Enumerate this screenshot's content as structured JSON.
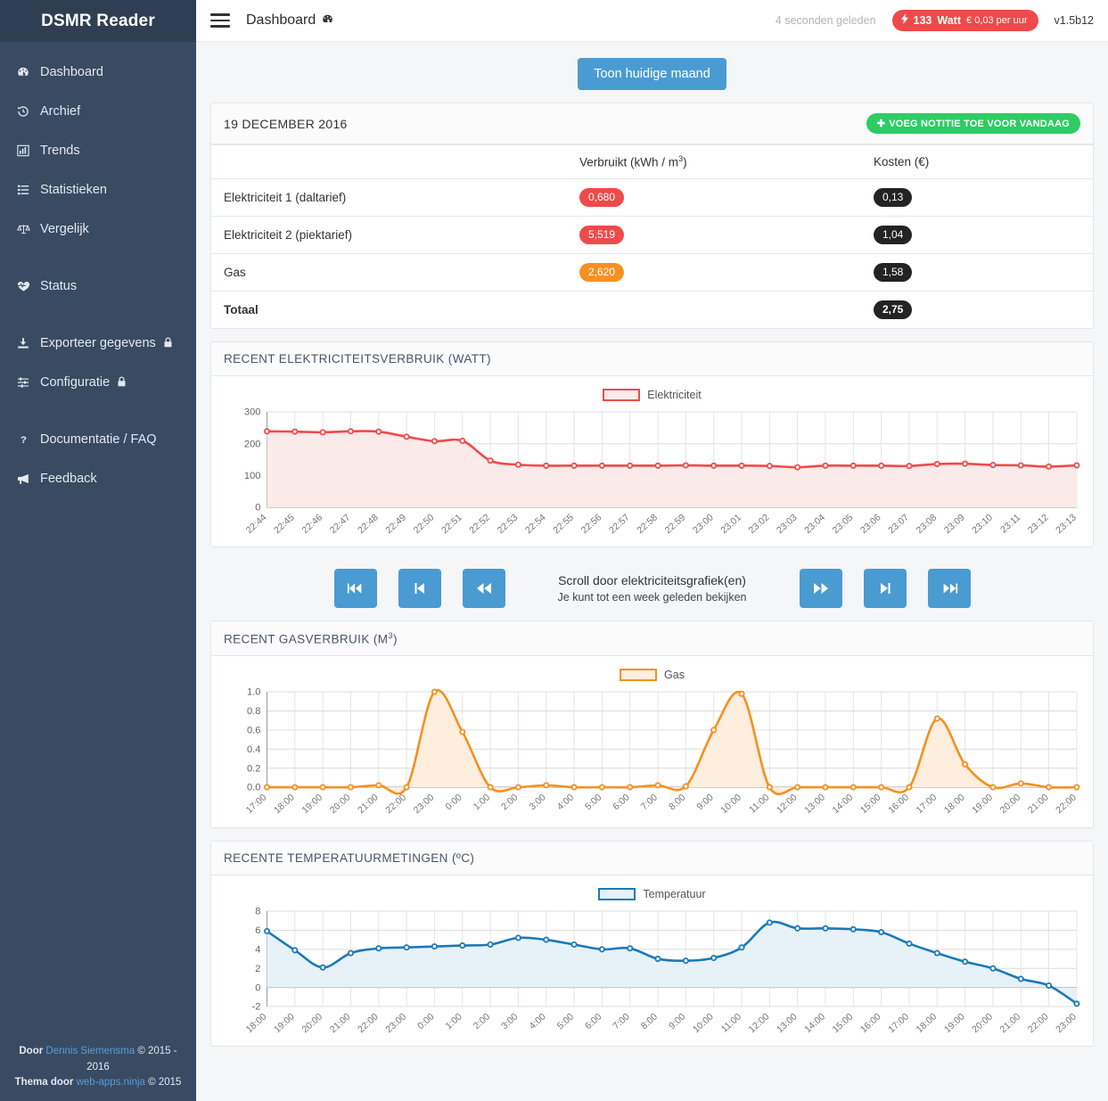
{
  "brand": {
    "name": "DSMR Reader"
  },
  "sidebar": {
    "items": [
      {
        "label": "Dashboard",
        "icon": "tachometer-icon",
        "locked": false
      },
      {
        "label": "Archief",
        "icon": "history-icon",
        "locked": false
      },
      {
        "label": "Trends",
        "icon": "bar-chart-icon",
        "locked": false
      },
      {
        "label": "Statistieken",
        "icon": "list-icon",
        "locked": false
      },
      {
        "label": "Vergelijk",
        "icon": "balance-scale-icon",
        "locked": false
      },
      {
        "label": "Status",
        "icon": "heartbeat-icon",
        "locked": false
      },
      {
        "label": "Exporteer gegevens",
        "icon": "download-icon",
        "locked": true
      },
      {
        "label": "Configuratie",
        "icon": "sliders-icon",
        "locked": true
      },
      {
        "label": "Documentatie / FAQ",
        "icon": "question-icon",
        "locked": false
      },
      {
        "label": "Feedback",
        "icon": "bullhorn-icon",
        "locked": false
      }
    ],
    "footer": {
      "line1_prefix": "Door ",
      "line1_link": "Dennis Siemensma",
      "line1_suffix": " © 2015 - 2016",
      "line2_prefix": "Thema door ",
      "line2_link": "web-apps.ninja",
      "line2_suffix": " © 2015"
    }
  },
  "topbar": {
    "title": "Dashboard",
    "title_icon": "tachometer-icon",
    "menu_icon": "hamburger-icon",
    "last_update": "4 seconden geleden",
    "live": {
      "bolt_icon": "bolt-icon",
      "watt": "133",
      "unit": "Watt",
      "cost": "€ 0,03 per uur"
    },
    "version": "v1.5b12"
  },
  "actions": {
    "show_current_month": "Toon huidige maand"
  },
  "day_panel": {
    "date": "19 DECEMBER 2016",
    "add_note_button": "VOEG NOTITIE TOE VOOR VANDAAG",
    "add_note_icon": "plus-icon",
    "table": {
      "headers": {
        "name": "",
        "consumed": "Verbruikt (kWh / m",
        "consumed_sup": "3",
        "consumed_close": ")",
        "cost": "Kosten (€)"
      },
      "rows": [
        {
          "name": "Elektriciteit 1 (daltarief)",
          "consumed": "0,680",
          "consumed_color": "red",
          "cost": "0,13"
        },
        {
          "name": "Elektriciteit 2 (piektarief)",
          "consumed": "5,519",
          "consumed_color": "red",
          "cost": "1,04"
        },
        {
          "name": "Gas",
          "consumed": "2,620",
          "consumed_color": "orange",
          "cost": "1,58"
        },
        {
          "name": "Totaal",
          "consumed": "",
          "consumed_color": "none",
          "cost": "2,75"
        }
      ]
    }
  },
  "electricity_panel": {
    "title": "RECENT ELEKTRICITEITSVERBRUIK (WATT)"
  },
  "gas_panel": {
    "title_prefix": "RECENT GASVERBRUIK (M",
    "title_sup": "3",
    "title_suffix": ")"
  },
  "temperature_panel": {
    "title": "RECENTE TEMPERATUURMETINGEN (ºC)"
  },
  "scroller": {
    "line1": "Scroll door elektriciteitsgrafiek(en)",
    "line2": "Je kunt tot een week geleden bekijken",
    "buttons": [
      {
        "name": "scroll-fastest-back",
        "glyph": "⏮⏮"
      },
      {
        "name": "scroll-step-back-far",
        "glyph": "⏮"
      },
      {
        "name": "scroll-back",
        "glyph": "⏪"
      },
      {
        "name": "scroll-forward",
        "glyph": "⏩"
      },
      {
        "name": "scroll-step-forward-far",
        "glyph": "⏭"
      },
      {
        "name": "scroll-fastest-forward",
        "glyph": "⏭⏭"
      }
    ]
  },
  "colors": {
    "sidebar_bg": "#394b63",
    "brand_bg": "#2f3e52",
    "accent_blue": "#4a9bd1",
    "red": "#ef4a4a",
    "orange": "#f59121",
    "green": "#2ecc62",
    "dark_pill": "#232323"
  },
  "chart_data": [
    {
      "type": "area",
      "name": "electricity",
      "title": "RECENT ELEKTRICITEITSVERBRUIK (WATT)",
      "legend": [
        "Elektriciteit"
      ],
      "legend_position": "top-center",
      "line_color": "#ef4a4a",
      "fill_color": "#fbeaea",
      "grid": true,
      "xlabel": "",
      "ylabel": "Watt",
      "ylim": [
        0,
        300
      ],
      "yticks": [
        0,
        100,
        200,
        300
      ],
      "x": [
        "22:44",
        "22:45",
        "22:46",
        "22:47",
        "22:48",
        "22:49",
        "22:50",
        "22:51",
        "22:52",
        "22:53",
        "22:54",
        "22:55",
        "22:56",
        "22:57",
        "22:58",
        "22:59",
        "23:00",
        "23:01",
        "23:02",
        "23:03",
        "23:04",
        "23:05",
        "23:06",
        "23:07",
        "23:08",
        "23:09",
        "23:10",
        "23:11",
        "23:12",
        "23:13"
      ],
      "values": [
        239,
        238,
        236,
        239,
        238,
        222,
        208,
        209,
        147,
        134,
        131,
        131,
        131,
        131,
        131,
        132,
        131,
        131,
        130,
        126,
        131,
        131,
        131,
        130,
        136,
        137,
        133,
        132,
        128,
        132
      ]
    },
    {
      "type": "area",
      "name": "gas",
      "title": "RECENT GASVERBRUIK (M3)",
      "legend": [
        "Gas"
      ],
      "legend_position": "top-center",
      "line_color": "#f5901f",
      "fill_color": "#fdeedd",
      "grid": true,
      "xlabel": "",
      "ylabel": "m3",
      "ylim": [
        0,
        1.0
      ],
      "yticks": [
        0,
        0.2,
        0.4,
        0.6,
        0.8,
        1.0
      ],
      "x": [
        "17:00",
        "18:00",
        "19:00",
        "20:00",
        "21:00",
        "22:00",
        "23:00",
        "0:00",
        "1:00",
        "2:00",
        "3:00",
        "4:00",
        "5:00",
        "6:00",
        "7:00",
        "8:00",
        "9:00",
        "10:00",
        "11:00",
        "12:00",
        "13:00",
        "14:00",
        "15:00",
        "16:00",
        "17:00",
        "18:00",
        "19:00",
        "20:00",
        "21:00",
        "22:00"
      ],
      "values": [
        0.0,
        0.0,
        0.0,
        0.0,
        0.02,
        0.0,
        1.0,
        0.58,
        0.0,
        0.0,
        0.02,
        0.0,
        0.0,
        0.0,
        0.02,
        0.01,
        0.6,
        0.98,
        0.0,
        0.0,
        0.0,
        0.0,
        0.0,
        0.0,
        0.72,
        0.24,
        0.0,
        0.04,
        0.0,
        0.0
      ]
    },
    {
      "type": "area",
      "name": "temperature",
      "title": "RECENTE TEMPERATUURMETINGEN (ºC)",
      "legend": [
        "Temperatuur"
      ],
      "legend_position": "top-center",
      "line_color": "#1b79b8",
      "fill_color": "#e7f1f8",
      "grid": true,
      "xlabel": "",
      "ylabel": "ºC",
      "ylim": [
        -2,
        8
      ],
      "yticks": [
        -2,
        0,
        2,
        4,
        6,
        8
      ],
      "x": [
        "18:00",
        "19:00",
        "20:00",
        "21:00",
        "22:00",
        "23:00",
        "0:00",
        "1:00",
        "2:00",
        "3:00",
        "4:00",
        "5:00",
        "6:00",
        "7:00",
        "8:00",
        "9:00",
        "10:00",
        "11:00",
        "12:00",
        "13:00",
        "14:00",
        "15:00",
        "16:00",
        "17:00",
        "18:00",
        "19:00",
        "20:00",
        "21:00",
        "22:00",
        "23:00"
      ],
      "values": [
        5.9,
        3.9,
        2.1,
        3.6,
        4.1,
        4.2,
        4.3,
        4.4,
        4.5,
        5.2,
        5.0,
        4.5,
        4.0,
        4.1,
        3.0,
        2.8,
        3.1,
        4.2,
        6.8,
        6.2,
        6.2,
        6.1,
        5.8,
        4.6,
        3.6,
        2.7,
        2.0,
        0.9,
        0.2,
        -1.7
      ]
    }
  ]
}
